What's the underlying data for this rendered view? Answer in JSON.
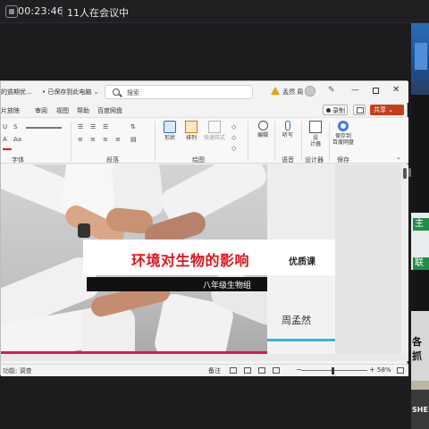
{
  "meeting": {
    "timer": "00:23:46",
    "participants": "11人在会议中"
  },
  "ppt": {
    "doc_name": "的逾期优...",
    "save_status": "• 已保存到此电脑 ⌄",
    "search_placeholder": "搜索",
    "user_name": "孟然 周",
    "menu_tabs": [
      "片放映",
      "审阅",
      "视图",
      "帮助",
      "百度网盘"
    ],
    "record_label": "录制",
    "share_label": "共享 ⌄",
    "ribbon": {
      "groups": {
        "font": "字体",
        "paragraph": "段落",
        "drawing": "绘图",
        "voice": "语音",
        "designer": "设计器",
        "save": "保存"
      },
      "buttons": {
        "shapes": "形状",
        "arrange": "排列",
        "quick_styles": "快速样式",
        "edit": "编辑",
        "dictate": "听写",
        "designer": "设\n计器",
        "save_to_baidu": "保存到\n百度网盘"
      }
    },
    "slide": {
      "title": "环境对生物的影响",
      "title_suffix": "优质课",
      "grade": "八年级生物组",
      "teacher": "周孟然"
    },
    "status": {
      "left": "功能: 调查",
      "notes": "备注",
      "zoom": "58%"
    }
  },
  "gallery": {
    "tile_labels": [
      "主",
      "联",
      "各抓",
      "SHE"
    ]
  },
  "colors": {
    "title_red": "#e0141b",
    "accent_cyan": "#33b6d6",
    "accent_pink": "#d6195c",
    "share_red": "#c43e1c"
  }
}
